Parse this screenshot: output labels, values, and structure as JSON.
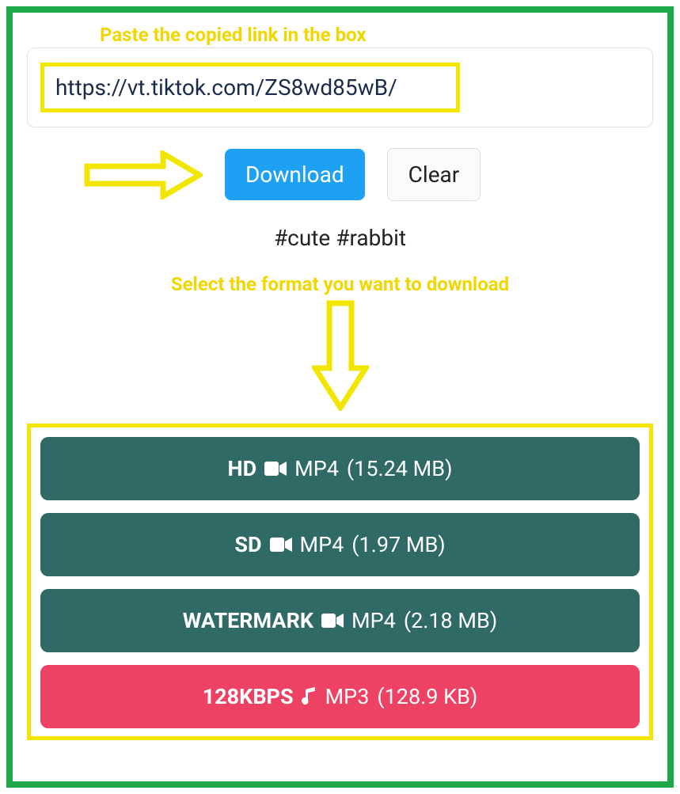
{
  "hints": {
    "top": "Paste the copied link in the box",
    "mid": "Select the format you want to download"
  },
  "url_input": {
    "value": "https://vt.tiktok.com/ZS8wd85wB/"
  },
  "actions": {
    "download_label": "Download",
    "clear_label": "Clear"
  },
  "hashtags": "#cute #rabbit",
  "formats": [
    {
      "quality": "HD",
      "icon": "video",
      "ext": "MP4",
      "size": "15.24 MB",
      "color": "teal"
    },
    {
      "quality": "SD",
      "icon": "video",
      "ext": "MP4",
      "size": "1.97 MB",
      "color": "teal"
    },
    {
      "quality": "WATERMARK",
      "icon": "video",
      "ext": "MP4",
      "size": "2.18 MB",
      "color": "teal"
    },
    {
      "quality": "128KBPS",
      "icon": "music",
      "ext": "MP3",
      "size": "128.9 KB",
      "color": "red"
    }
  ]
}
